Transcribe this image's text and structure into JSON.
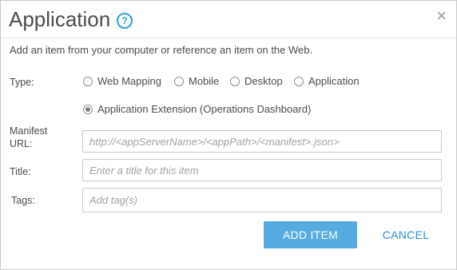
{
  "dialog": {
    "title": "Application",
    "help_icon": "question-circle-icon",
    "close_glyph": "×",
    "description": "Add an item from your computer or reference an item on the Web."
  },
  "type": {
    "label": "Type:",
    "options": [
      "Web Mapping",
      "Mobile",
      "Desktop",
      "Application",
      "Application Extension (Operations Dashboard)"
    ],
    "selected": "Application Extension (Operations Dashboard)"
  },
  "manifest": {
    "label_line1": "Manifest",
    "label_line2": "URL:",
    "placeholder": "http://<appServerName>/<appPath>/<manifest>.json>"
  },
  "title_field": {
    "label": "Title:",
    "placeholder": "Enter a title for this item"
  },
  "tags_field": {
    "label": "Tags:",
    "placeholder": "Add tag(s)"
  },
  "buttons": {
    "add": "ADD ITEM",
    "cancel": "CANCEL"
  },
  "colors": {
    "accent": "#56ace0",
    "link": "#2e8fd4",
    "text": "#4c4c4c"
  }
}
